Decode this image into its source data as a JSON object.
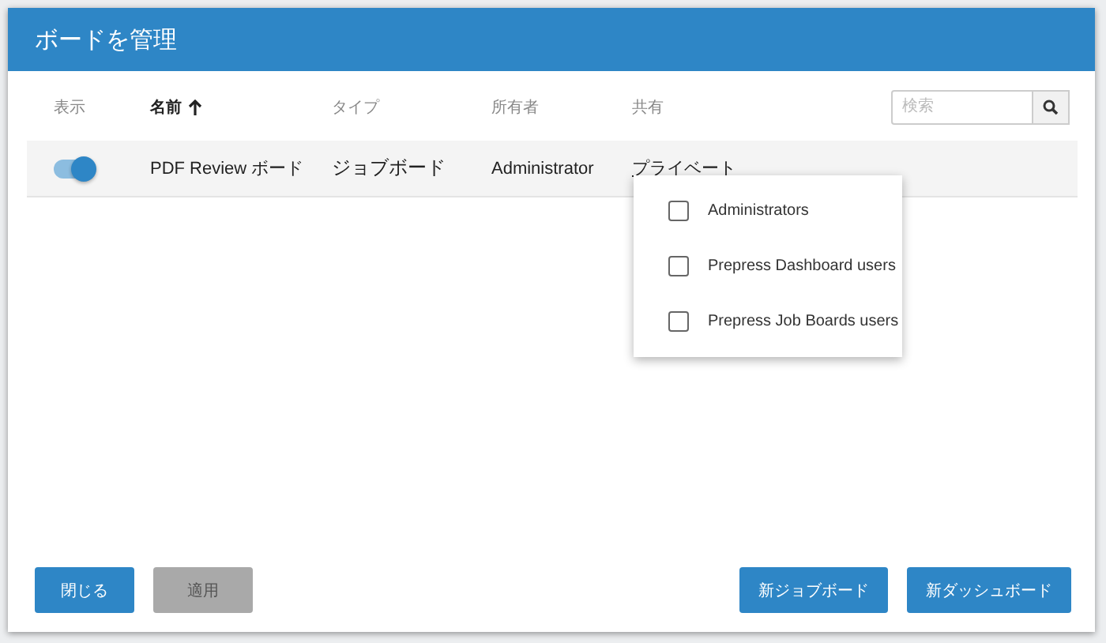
{
  "dialog": {
    "title": "ボードを管理"
  },
  "columns": [
    {
      "label": "表示",
      "sorted": false
    },
    {
      "label": "名前",
      "sorted": true
    },
    {
      "label": "タイプ",
      "sorted": false
    },
    {
      "label": "所有者",
      "sorted": false
    },
    {
      "label": "共有",
      "sorted": false
    }
  ],
  "search": {
    "placeholder": "検索"
  },
  "rows": [
    {
      "visible": true,
      "name": "PDF Review ボード",
      "type": "ジョブボード",
      "owner": "Administrator",
      "sharing": "プライベート"
    }
  ],
  "share_menu": [
    {
      "label": "Administrators",
      "checked": false
    },
    {
      "label": "Prepress Dashboard users",
      "checked": false
    },
    {
      "label": "Prepress Job Boards users",
      "checked": false
    }
  ],
  "left_buttons": [
    {
      "label": "閉じる",
      "disabled": false
    },
    {
      "label": "適用",
      "disabled": true
    }
  ],
  "right_buttons": [
    {
      "label": "新ジョブボード",
      "disabled": false
    },
    {
      "label": "新ダッシュボード",
      "disabled": false
    }
  ]
}
